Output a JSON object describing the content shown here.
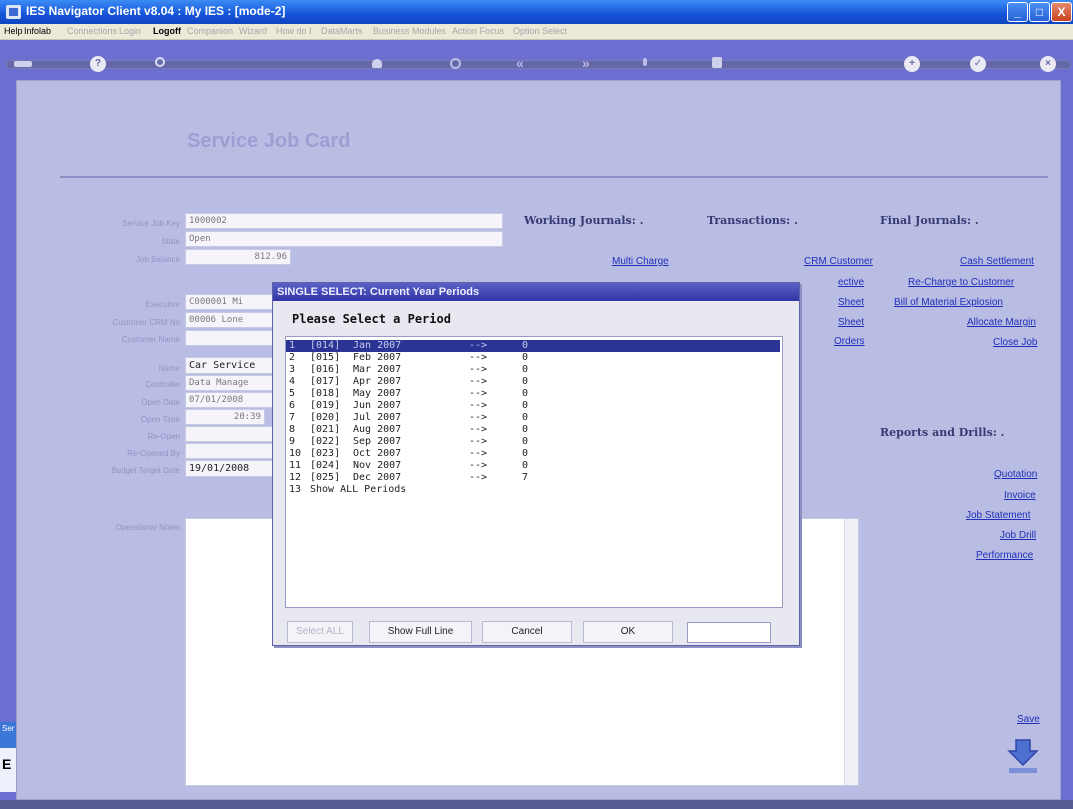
{
  "window": {
    "title": "IES Navigator Client v8.04 : My IES :      [mode-2]",
    "controls": {
      "minimize": "_",
      "maximize": "□",
      "close": "X"
    }
  },
  "menubar": [
    {
      "label": "Help",
      "enabled": true
    },
    {
      "label": "Infolab",
      "enabled": true
    },
    {
      "label": "Connections",
      "enabled": false
    },
    {
      "label": "Login",
      "enabled": false
    },
    {
      "label": "Logoff",
      "enabled": true,
      "bold": true
    },
    {
      "label": "Companion",
      "enabled": false
    },
    {
      "label": "Wizard",
      "enabled": false
    },
    {
      "label": "How do I",
      "enabled": false
    },
    {
      "label": "DataMarts",
      "enabled": false
    },
    {
      "label": "Business Modules",
      "enabled": false
    },
    {
      "label": "Action Focus",
      "enabled": false
    },
    {
      "label": "Option Select",
      "enabled": false
    }
  ],
  "toolbar": {
    "icons": [
      "home-icon",
      "help-icon",
      "search-icon",
      "heart-icon",
      "refresh-icon",
      "previous-icon",
      "next-icon",
      "tree-icon",
      "block-icon",
      "add-icon",
      "check-icon",
      "cancel-icon"
    ],
    "help": "?",
    "add": "+",
    "check": "✓",
    "cancel": "×",
    "prev": "«",
    "next": "»"
  },
  "page": {
    "title": "Service Job Card"
  },
  "form": {
    "labels": [
      "Service Job Key",
      "State",
      "Job Balance",
      "Executive",
      "Customer CRM No",
      "Customer Name",
      "Name",
      "Controller",
      "Open Date",
      "Open Time",
      "Re-Open",
      "Re-Opened By",
      "Budget Target Date",
      "Operational Notes"
    ],
    "values": {
      "job_key": "1000002",
      "state": "Open",
      "job_balance": "812.96",
      "executive": "C000001 Mi",
      "crm_no": "00006 Lone",
      "name": "Car Service",
      "controller": "Data Manage",
      "open_date": "07/01/2008",
      "open_time": "20:39",
      "budget_date": "19/01/2008"
    }
  },
  "sections": {
    "working_journals": {
      "title": "Working Journals: .",
      "links": [
        "Multi Charge"
      ]
    },
    "transactions": {
      "title": "Transactions: .",
      "links": [
        "CRM Customer",
        "ective",
        "Sheet",
        "Sheet",
        "Orders"
      ]
    },
    "final_journals": {
      "title": "Final Journals: .",
      "links": [
        "Cash Settlement",
        "Re-Charge to Customer",
        "Bill of Material Explosion",
        "Allocate Margin",
        "Close Job"
      ]
    },
    "reports": {
      "title": "Reports and Drills: .",
      "links": [
        "Quotation",
        "Invoice",
        "Job Statement",
        "Job Drill",
        "Performance"
      ]
    },
    "save": "Save"
  },
  "left_edge": {
    "tab1": "Ser",
    "tab2": "E"
  },
  "dialog": {
    "title": "SINGLE SELECT: Current Year Periods",
    "heading": "Please Select a Period",
    "rows": [
      {
        "num": "1",
        "code": "[014]",
        "period": "Jan 2007",
        "arrow": "-->",
        "count": "0",
        "selected": true
      },
      {
        "num": "2",
        "code": "[015]",
        "period": "Feb 2007",
        "arrow": "-->",
        "count": "0"
      },
      {
        "num": "3",
        "code": "[016]",
        "period": "Mar 2007",
        "arrow": "-->",
        "count": "0"
      },
      {
        "num": "4",
        "code": "[017]",
        "period": "Apr 2007",
        "arrow": "-->",
        "count": "0"
      },
      {
        "num": "5",
        "code": "[018]",
        "period": "May 2007",
        "arrow": "-->",
        "count": "0"
      },
      {
        "num": "6",
        "code": "[019]",
        "period": "Jun 2007",
        "arrow": "-->",
        "count": "0"
      },
      {
        "num": "7",
        "code": "[020]",
        "period": "Jul 2007",
        "arrow": "-->",
        "count": "0"
      },
      {
        "num": "8",
        "code": "[021]",
        "period": "Aug 2007",
        "arrow": "-->",
        "count": "0"
      },
      {
        "num": "9",
        "code": "[022]",
        "period": "Sep 2007",
        "arrow": "-->",
        "count": "0"
      },
      {
        "num": "10",
        "code": "[023]",
        "period": "Oct 2007",
        "arrow": "-->",
        "count": "0"
      },
      {
        "num": "11",
        "code": "[024]",
        "period": "Nov 2007",
        "arrow": "-->",
        "count": "0"
      },
      {
        "num": "12",
        "code": "[025]",
        "period": "Dec 2007",
        "arrow": "-->",
        "count": "7"
      },
      {
        "num": "13",
        "code": "Show ALL Periods",
        "period": "",
        "arrow": "",
        "count": ""
      }
    ],
    "buttons": {
      "select_all": "Select ALL",
      "show_full_line": "Show Full Line",
      "cancel": "Cancel",
      "ok": "OK"
    },
    "input_value": ""
  },
  "colors": {
    "titlebar": "#1554d8",
    "background": "#6c6fd0",
    "panel": "#babde3",
    "link": "#1f2fb8",
    "selection": "#2a3494"
  }
}
